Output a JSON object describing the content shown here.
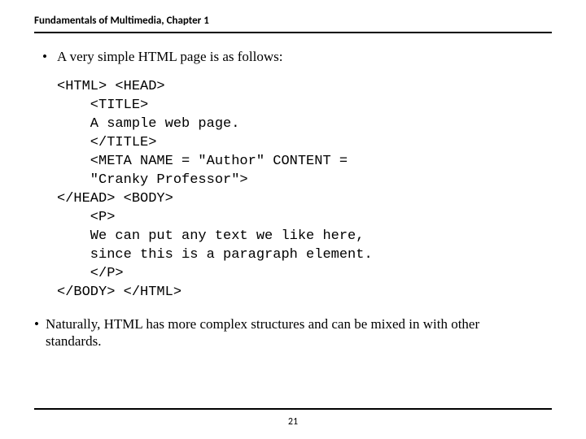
{
  "header": {
    "title": "Fundamentals of Multimedia, Chapter 1"
  },
  "content": {
    "bullet1_symbol": "•",
    "bullet1_text": "A very simple HTML page is as follows:",
    "code": "<HTML> <HEAD>\n    <TITLE>\n    A sample web page.\n    </TITLE>\n    <META NAME = \"Author\" CONTENT =\n    \"Cranky Professor\">\n</HEAD> <BODY>\n    <P>\n    We can put any text we like here,\n    since this is a paragraph element.\n    </P>\n</BODY> </HTML>",
    "bullet2_symbol": "•",
    "bullet2_text": "Naturally, HTML has more complex structures and can be mixed in with other standards."
  },
  "footer": {
    "page_number": "21"
  }
}
